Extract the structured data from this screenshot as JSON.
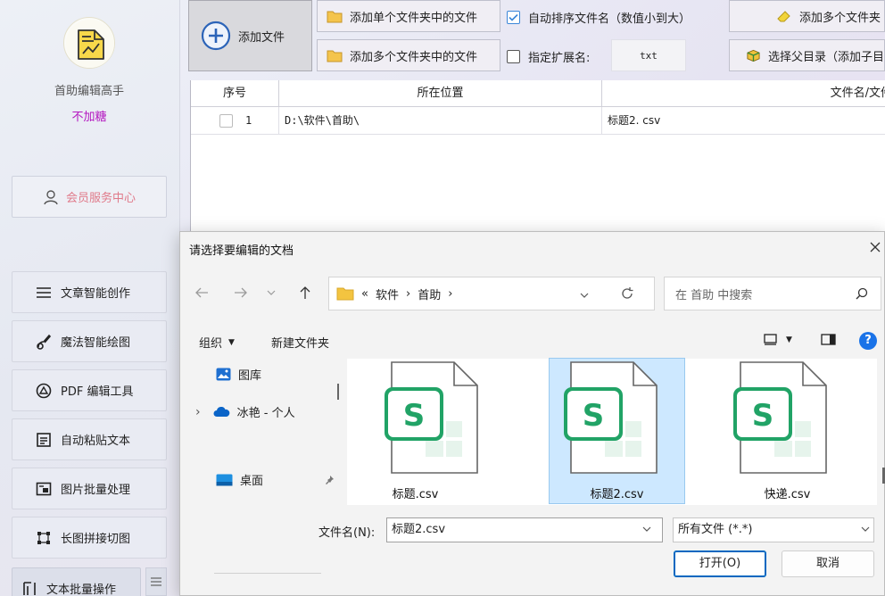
{
  "sidebar": {
    "app_name": "首助编辑高手",
    "badge": "不加糖",
    "member_center": "会员服务中心",
    "items": [
      {
        "label": "文章智能创作"
      },
      {
        "label": "魔法智能绘图"
      },
      {
        "label": "PDF 编辑工具"
      },
      {
        "label": "自动粘贴文本"
      },
      {
        "label": "图片批量处理"
      },
      {
        "label": "长图拼接切图"
      },
      {
        "label": "文本批量操作"
      }
    ]
  },
  "toolbar": {
    "add_file": "添加文件",
    "add_single_folder": "添加单个文件夹中的文件",
    "add_multi_folders": "添加多个文件夹中的文件",
    "auto_sort": "自动排序文件名（数值小到大）",
    "auto_sort_checked": true,
    "specify_ext": "指定扩展名:",
    "specify_ext_checked": false,
    "ext_value": "txt",
    "add_multi_files": "添加多个文件夹",
    "choose_parent": "选择父目录（添加子目"
  },
  "table": {
    "columns": [
      "序号",
      "所在位置",
      "文件名/文件"
    ],
    "rows": [
      {
        "index": "1",
        "location": "D:\\软件\\首助\\",
        "filename": "标题2. csv"
      }
    ]
  },
  "dialog": {
    "title": "请选择要编辑的文档",
    "breadcrumb": {
      "prefix": "«",
      "parts": [
        "软件",
        "首助"
      ]
    },
    "search_placeholder": "在 首助 中搜索",
    "organize": "组织",
    "new_folder": "新建文件夹",
    "tree": [
      {
        "label": "图库"
      },
      {
        "label": "冰艳 - 个人"
      },
      {
        "label": "桌面"
      }
    ],
    "files": [
      {
        "name": "标题.csv",
        "selected": false
      },
      {
        "name": "标题2.csv",
        "selected": true
      },
      {
        "name": "快递.csv",
        "selected": false
      }
    ],
    "filename_label": "文件名(N):",
    "filename_value": "标题2.csv",
    "filter_value": "所有文件 (*.*)",
    "open_button": "打开(O)",
    "cancel_button": "取消"
  },
  "colors": {
    "badge": "#b418c0",
    "member": "#e07a8a",
    "excel_green": "#21a366",
    "accent_blue": "#0067c0"
  }
}
